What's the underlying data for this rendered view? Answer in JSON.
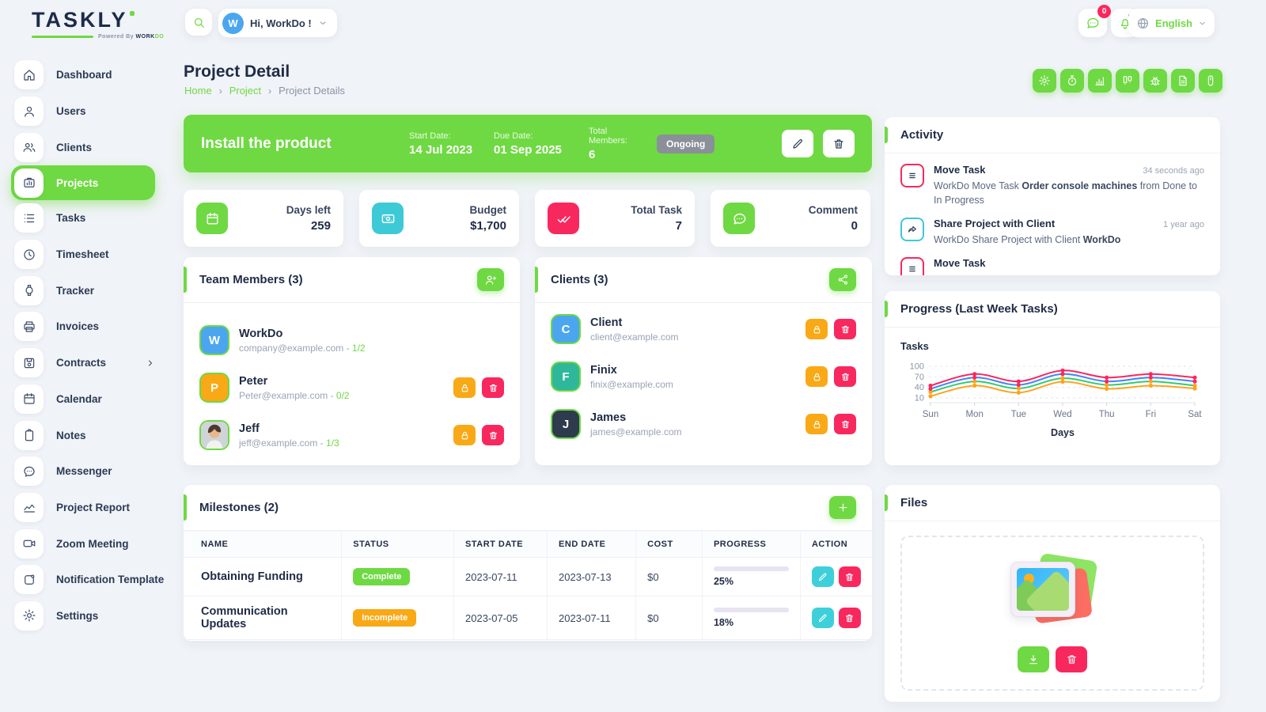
{
  "logo": {
    "brand_a": "TASK",
    "brand_b": "LY",
    "powered_prefix": "Powered By ",
    "powered_a": "WORK",
    "powered_b": "DO"
  },
  "header": {
    "greeting": "Hi, WorkDo !",
    "avatar_initial": "W",
    "message_badge": "0",
    "language": "English"
  },
  "sidebar": {
    "items": [
      {
        "label": "Dashboard",
        "icon": "home",
        "active": false
      },
      {
        "label": "Users",
        "icon": "user",
        "active": false
      },
      {
        "label": "Clients",
        "icon": "clients",
        "active": false
      },
      {
        "label": "Projects",
        "icon": "projects",
        "active": true
      },
      {
        "label": "Tasks",
        "icon": "tasks",
        "active": false
      },
      {
        "label": "Timesheet",
        "icon": "clock",
        "active": false
      },
      {
        "label": "Tracker",
        "icon": "watch",
        "active": false
      },
      {
        "label": "Invoices",
        "icon": "printer",
        "active": false
      },
      {
        "label": "Contracts",
        "icon": "contract",
        "active": false,
        "chevron": true
      },
      {
        "label": "Calendar",
        "icon": "calendar",
        "active": false
      },
      {
        "label": "Notes",
        "icon": "notes",
        "active": false
      },
      {
        "label": "Messenger",
        "icon": "chat-dots",
        "active": false
      },
      {
        "label": "Project Report",
        "icon": "trend",
        "active": false
      },
      {
        "label": "Zoom Meeting",
        "icon": "video",
        "active": false
      },
      {
        "label": "Notification Template",
        "icon": "template",
        "active": false
      },
      {
        "label": "Settings",
        "icon": "gear",
        "active": false
      }
    ]
  },
  "page": {
    "title": "Project Detail",
    "breadcrumb": [
      "Home",
      "Project",
      "Project Details"
    ]
  },
  "toolbar": {
    "buttons": [
      "gear",
      "stopwatch",
      "bar-chart",
      "kanban",
      "bug",
      "file",
      "mouse"
    ]
  },
  "banner": {
    "title": "Install the product",
    "start_label": "Start Date:",
    "start_value": "14 Jul 2023",
    "due_label": "Due Date:",
    "due_value": "01 Sep 2025",
    "members_label": "Total Members:",
    "members_value": "6",
    "status": "Ongoing"
  },
  "stats": [
    {
      "label": "Days left",
      "value": "259",
      "icon": "calendar",
      "color": "#6fd943"
    },
    {
      "label": "Budget",
      "value": "$1,700",
      "icon": "money",
      "color": "#3ec9d6"
    },
    {
      "label": "Total Task",
      "value": "7",
      "icon": "double-check",
      "color": "#f8285f"
    },
    {
      "label": "Comment",
      "value": "0",
      "icon": "chat",
      "color": "#6fd943"
    }
  ],
  "team": {
    "title": "Team Members (3)",
    "members": [
      {
        "name": "WorkDo",
        "email": "company@example.com",
        "ratio": "1/2",
        "initial": "W",
        "color": "#4ba6ef",
        "photo": false,
        "actions": false
      },
      {
        "name": "Peter",
        "email": "Peter@example.com",
        "ratio": "0/2",
        "initial": "P",
        "color": "#f9a916",
        "photo": false,
        "actions": true
      },
      {
        "name": "Jeff",
        "email": "jeff@example.com",
        "ratio": "1/3",
        "initial": "J",
        "color": "#cfd4d8",
        "photo": true,
        "actions": true
      }
    ]
  },
  "clients": {
    "title": "Clients (3)",
    "members": [
      {
        "name": "Client",
        "email": "client@example.com",
        "initial": "C",
        "color": "#4ba6ef"
      },
      {
        "name": "Finix",
        "email": "finix@example.com",
        "initial": "F",
        "color": "#2eb79a"
      },
      {
        "name": "James",
        "email": "james@example.com",
        "initial": "J",
        "color": "#2e3a4e"
      }
    ]
  },
  "milestones": {
    "title": "Milestones (2)",
    "headers": [
      "NAME",
      "STATUS",
      "START DATE",
      "END DATE",
      "COST",
      "PROGRESS",
      "ACTION"
    ],
    "rows": [
      {
        "name": "Obtaining Funding",
        "status": "Complete",
        "status_color": "#6fd943",
        "start": "2023-07-11",
        "end": "2023-07-13",
        "cost": "$0",
        "progress": "25%"
      },
      {
        "name": "Communication Updates",
        "status": "Incomplete",
        "status_color": "#f9a916",
        "start": "2023-07-05",
        "end": "2023-07-11",
        "cost": "$0",
        "progress": "18%"
      }
    ]
  },
  "activity": {
    "title": "Activity",
    "items": [
      {
        "icon": "list",
        "icon_color": "#f8285f",
        "title": "Move Task",
        "time": "34 seconds ago",
        "desc_pre": "WorkDo Move Task ",
        "desc_bold": "Order console machines",
        "desc_post": " from Done to In Progress"
      },
      {
        "icon": "share-arrow",
        "icon_color": "#3ec9d6",
        "title": "Share Project with Client",
        "time": "1 year ago",
        "desc_pre": "WorkDo Share Project with Client ",
        "desc_bold": "WorkDo",
        "desc_post": ""
      },
      {
        "icon": "list",
        "icon_color": "#f8285f",
        "title": "Move Task",
        "time": "",
        "desc_pre": "",
        "desc_bold": "",
        "desc_post": ""
      }
    ]
  },
  "progress_card": {
    "title": "Progress (Last Week Tasks)"
  },
  "chart_data": {
    "type": "line",
    "title": "Progress (Last Week Tasks)",
    "x": [
      "Sun",
      "Mon",
      "Tue",
      "Wed",
      "Thu",
      "Fri",
      "Sat"
    ],
    "xlabel": "Days",
    "ylabel": "Tasks",
    "yticks": [
      10,
      40,
      70,
      100
    ],
    "ylim": [
      0,
      110
    ],
    "grid": true,
    "legend": false,
    "series": [
      {
        "name": "series-red",
        "color": "#f8285f",
        "marker": "#f8285f",
        "values": [
          45,
          78,
          57,
          88,
          68,
          78,
          68
        ]
      },
      {
        "name": "series-blue",
        "color": "#4680ff",
        "marker": "#f8285f",
        "values": [
          36,
          68,
          47,
          78,
          57,
          68,
          57
        ]
      },
      {
        "name": "series-green",
        "color": "#2ecc71",
        "marker": "#ffa21d",
        "values": [
          27,
          57,
          37,
          66,
          47,
          57,
          45
        ]
      },
      {
        "name": "series-orange",
        "color": "#ffa21d",
        "marker": "#ffa21d",
        "values": [
          15,
          45,
          25,
          56,
          36,
          45,
          37
        ]
      }
    ]
  },
  "files": {
    "title": "Files"
  }
}
